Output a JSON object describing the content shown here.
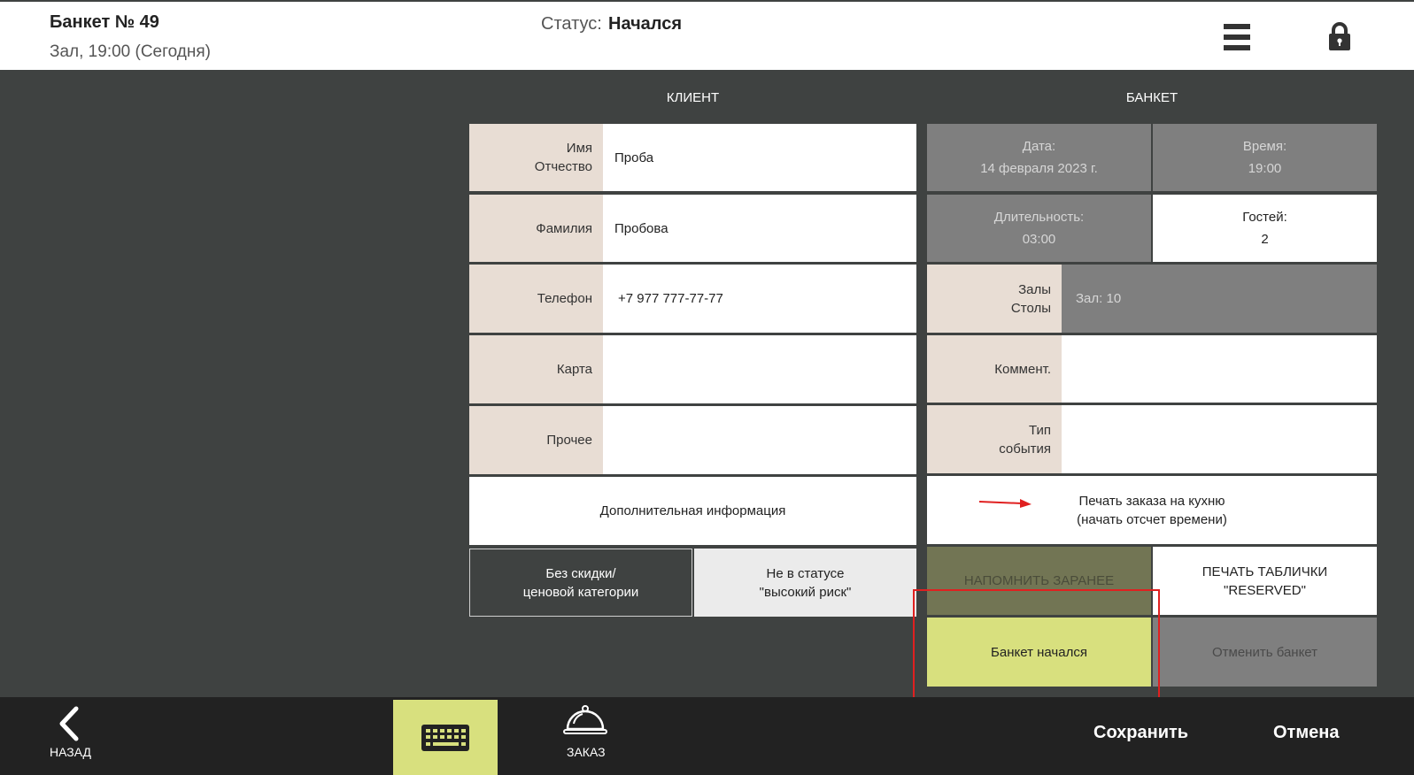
{
  "header": {
    "title": "Банкет № 49",
    "subtitle": "Зал, 19:00 (Сегодня)",
    "status_label": "Статус:",
    "status_value": "Начался"
  },
  "client": {
    "heading": "КЛИЕНТ",
    "name_label_1": "Имя",
    "name_label_2": "Отчество",
    "name_value": "Проба",
    "surname_label": "Фамилия",
    "surname_value": "Пробова",
    "phone_label": "Телефон",
    "phone_value": "+7 977 777-77-77",
    "card_label": "Карта",
    "card_value": "",
    "other_label": "Прочее",
    "other_value": "",
    "extra_info": "Дополнительная информация",
    "discount_1": "Без скидки/",
    "discount_2": "ценовой категории",
    "risk_1": "Не в статусе",
    "risk_2": "\"высокий риск\""
  },
  "banquet": {
    "heading": "БАНКЕТ",
    "date_label": "Дата:",
    "date_value": "14 февраля 2023 г.",
    "time_label": "Время:",
    "time_value": "19:00",
    "duration_label": "Длительность:",
    "duration_value": "03:00",
    "guests_label": "Гостей:",
    "guests_value": "2",
    "halls_label_1": "Залы",
    "halls_label_2": "Столы",
    "halls_value": "Зал: 10",
    "comment_label": "Коммент.",
    "comment_value": "",
    "event_label_1": "Тип",
    "event_label_2": "события",
    "event_value": "",
    "print_kitchen_1": "Печать заказа на кухню",
    "print_kitchen_2": "(начать отсчет времени)",
    "remind": "НАПОМНИТЬ ЗАРАНЕЕ",
    "print_reserved_1": "ПЕЧАТЬ ТАБЛИЧКИ",
    "print_reserved_2": "\"RESERVED\"",
    "started": "Банкет начался",
    "cancel_banquet": "Отменить банкет"
  },
  "footer": {
    "back_label": "НАЗАД",
    "order_label": "ЗАКАЗ",
    "save": "Сохранить",
    "cancel": "Отмена"
  },
  "icons": {
    "menu": "hamburger-menu-icon",
    "lock": "lock-icon",
    "back": "chevron-left-icon",
    "keyboard": "keyboard-icon",
    "order": "cloche-icon",
    "arrow": "arrow-right-icon"
  },
  "colors": {
    "accent": "#d8e07e",
    "label_bg": "#e8ddd4",
    "highlight": "#e02020",
    "remind_bg": "#727554"
  }
}
